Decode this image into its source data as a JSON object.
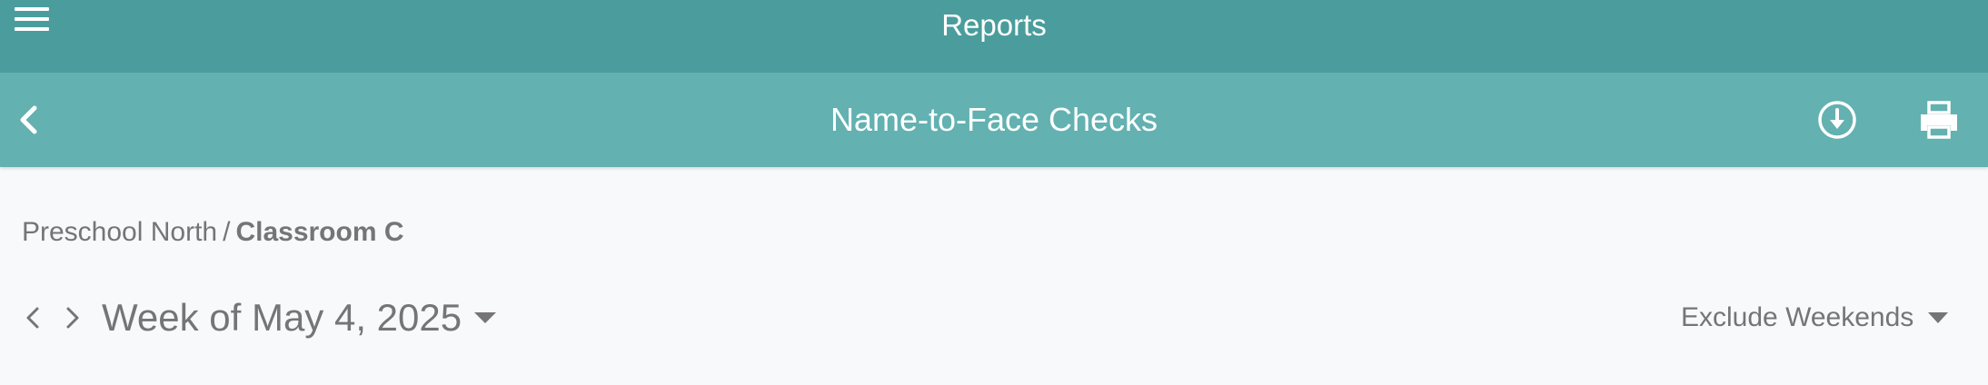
{
  "header": {
    "title": "Reports",
    "menu_icon": "hamburger-menu-icon"
  },
  "subheader": {
    "title": "Name-to-Face Checks",
    "back_icon": "chevron-left-icon",
    "download_icon": "download-circle-icon",
    "print_icon": "printer-icon"
  },
  "breadcrumb": {
    "parent": "Preschool North",
    "separator": "/",
    "current": "Classroom C"
  },
  "week_selector": {
    "label": "Week of May 4, 2025",
    "prev_icon": "chevron-left-icon",
    "next_icon": "chevron-right-icon",
    "dropdown_icon": "caret-down-icon"
  },
  "weekend_filter": {
    "selected": "Exclude Weekends",
    "dropdown_icon": "caret-down-icon"
  },
  "colors": {
    "topbar": "#4a9d9c",
    "subbar": "#63b1b1",
    "text_muted": "#757575",
    "background": "#f8f9fb"
  }
}
